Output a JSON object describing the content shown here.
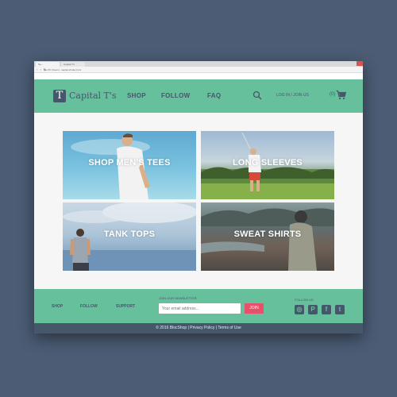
{
  "browser": {
    "tabs": [
      "Ne...",
      "Capital T's"
    ],
    "url": "file:///C:/Users/...capital-t/index.html"
  },
  "header": {
    "logo_letter": "T",
    "brand": "Capital T's",
    "nav": [
      "SHOP",
      "FOLLOW",
      "FAQ"
    ],
    "login": "LOG IN / JOIN US",
    "cart_count": "(0)"
  },
  "categories": [
    {
      "label": "SHOP MEN'S TEES"
    },
    {
      "label": "LONG SLEEVES"
    },
    {
      "label": "TANK TOPS"
    },
    {
      "label": "SWEAT SHIRTS"
    }
  ],
  "footer": {
    "links": [
      "SHOP",
      "FOLLOW",
      "SUPPORT"
    ],
    "newsletter_title": "JOIN OUR NEWSLETTER",
    "email_placeholder": "Your email address...",
    "join_label": "JOIN",
    "follow_title": "FOLLOW US",
    "social": [
      {
        "icon": "instagram-icon",
        "glyph": "◎"
      },
      {
        "icon": "pinterest-icon",
        "glyph": "P"
      },
      {
        "icon": "facebook-icon",
        "glyph": "f"
      },
      {
        "icon": "twitter-icon",
        "glyph": "t"
      }
    ],
    "copyright": "© 2016 BlocShop | Privacy Policy | Terms of Use"
  },
  "colors": {
    "accent": "#67c09c",
    "dark": "#46566b",
    "join_button": "#e8506a",
    "page_bg": "#4b5c74"
  }
}
